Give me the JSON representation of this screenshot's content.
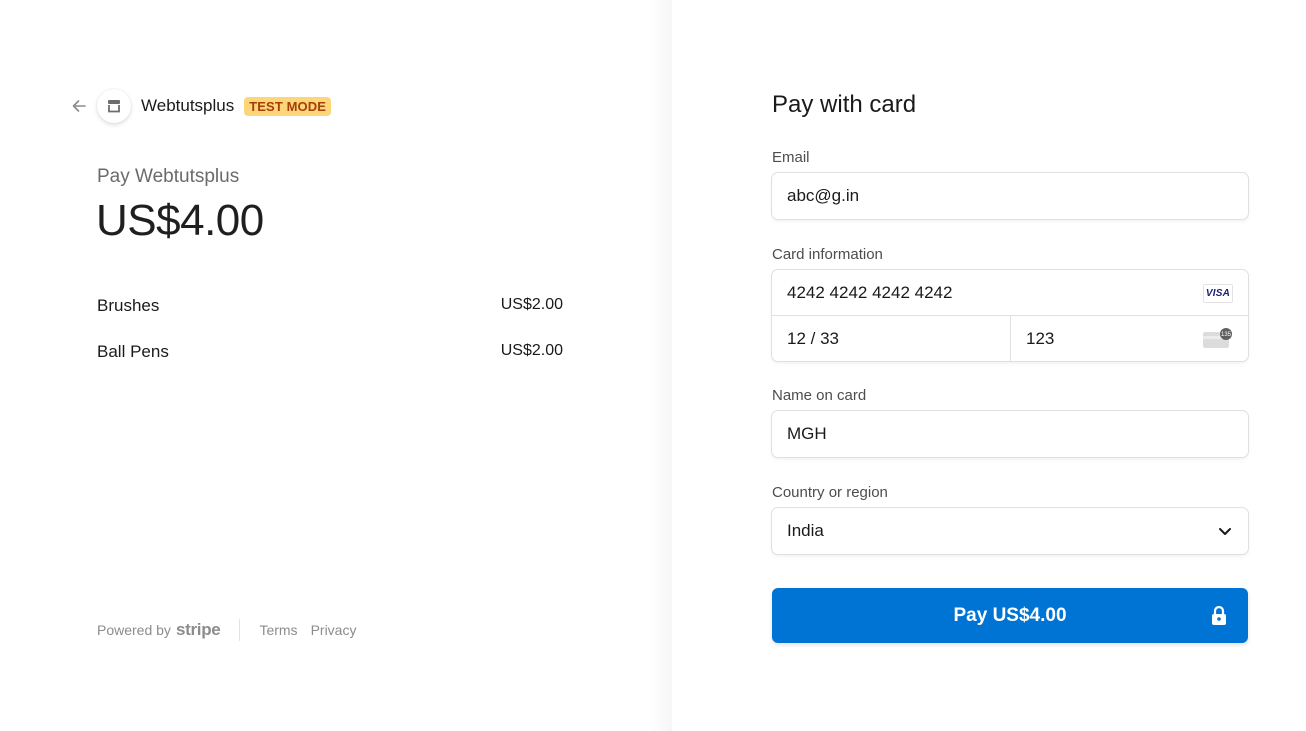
{
  "merchant": {
    "name": "Webtutsplus",
    "badge": "TEST MODE",
    "logo_icon": "store-icon",
    "back_icon": "arrow-left-icon"
  },
  "summary": {
    "pay_label": "Pay Webtutsplus",
    "total": "US$4.00",
    "items": [
      {
        "name": "Brushes",
        "price": "US$2.00"
      },
      {
        "name": "Ball Pens",
        "price": "US$2.00"
      }
    ]
  },
  "footer": {
    "powered_by": "Powered by",
    "brand": "stripe",
    "terms": "Terms",
    "privacy": "Privacy"
  },
  "form": {
    "title": "Pay with card",
    "email_label": "Email",
    "email_value": "abc@g.in",
    "card_label": "Card information",
    "card_number": "4242 4242 4242 4242",
    "card_brand": "VISA",
    "expiry": "12 / 33",
    "cvc": "123",
    "cvc_icon_text": "135",
    "name_label": "Name on card",
    "name_value": "MGH",
    "country_label": "Country or region",
    "country_value": "India",
    "pay_button": "Pay US$4.00"
  },
  "colors": {
    "accent": "#0074d4",
    "badge_bg": "#fcd679",
    "badge_text": "#a5400b"
  }
}
